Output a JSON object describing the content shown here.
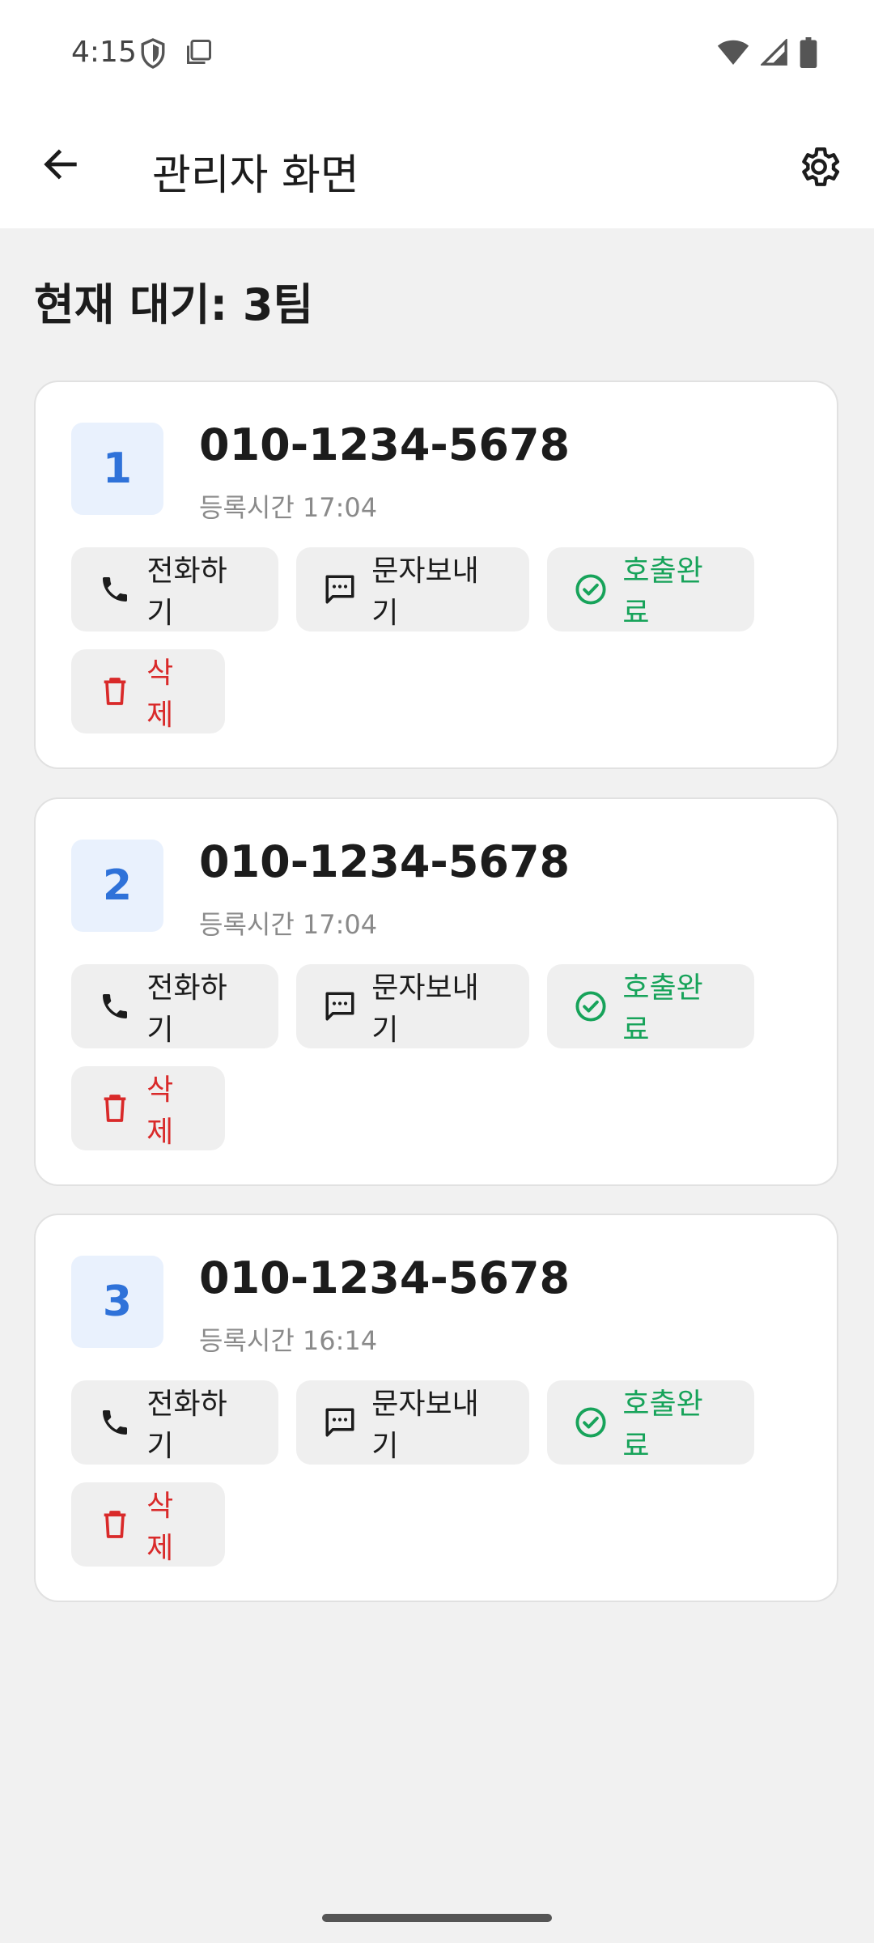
{
  "status_bar": {
    "time": "4:15"
  },
  "app_bar": {
    "title": "관리자 화면"
  },
  "summary": {
    "waiting_text": "현재 대기: 3팀"
  },
  "entries": [
    {
      "number": "1",
      "phone": "010-1234-5678",
      "registered": "등록시간 17:04"
    },
    {
      "number": "2",
      "phone": "010-1234-5678",
      "registered": "등록시간 17:04"
    },
    {
      "number": "3",
      "phone": "010-1234-5678",
      "registered": "등록시간 16:14"
    }
  ],
  "actions": {
    "call": "전화하기",
    "sms": "문자보내기",
    "complete": "호출완료",
    "delete": "삭제"
  },
  "colors": {
    "accent_blue": "#2f72d9",
    "success_green": "#17a35a",
    "danger_red": "#d92a2a"
  }
}
